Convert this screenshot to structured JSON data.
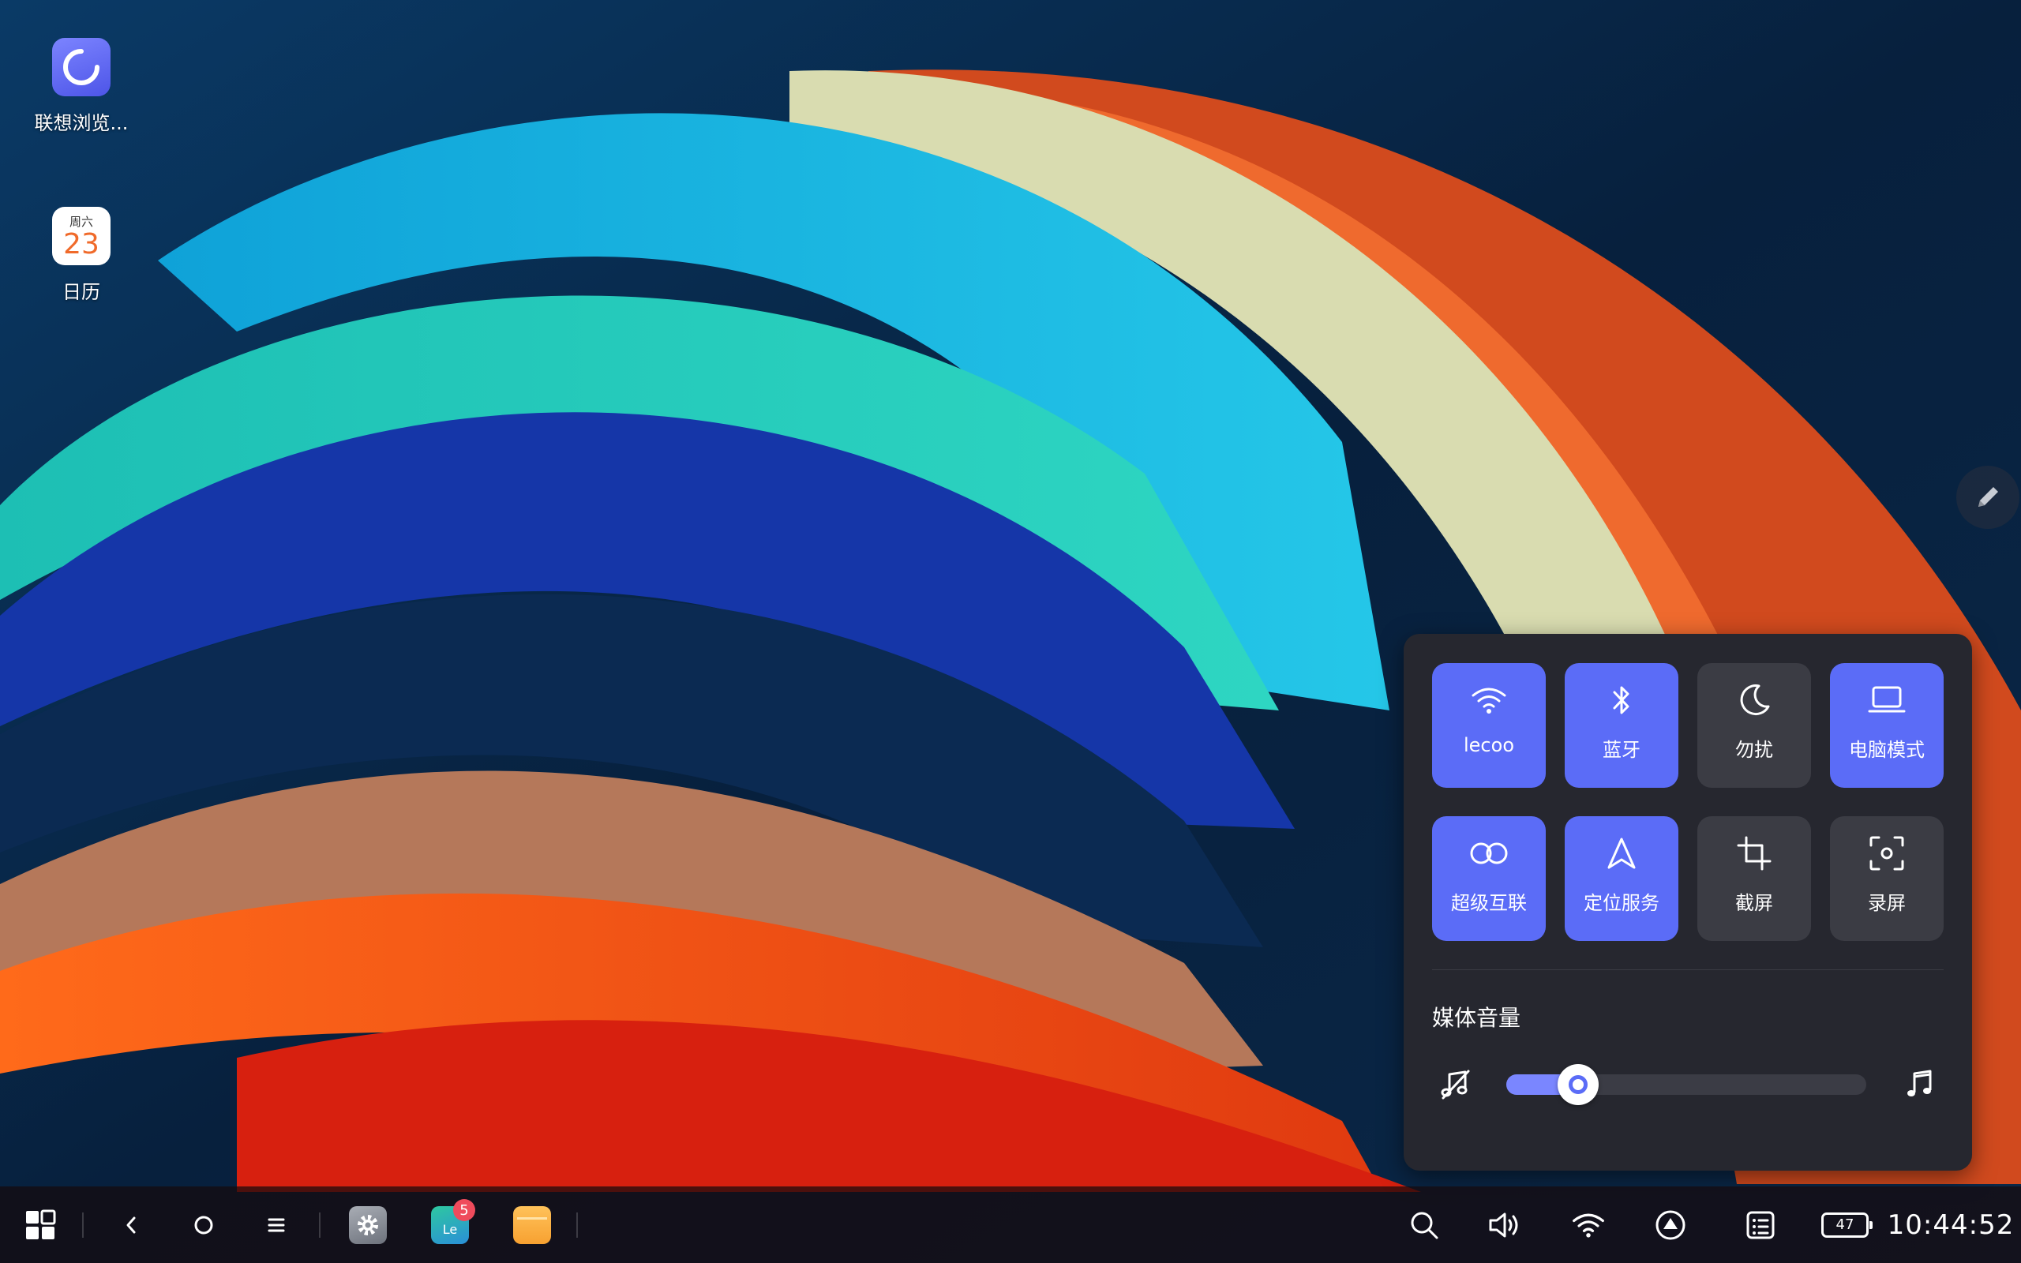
{
  "desktop": {
    "icons": [
      {
        "label": "联想浏览...",
        "icon": "browser-icon"
      },
      {
        "label": "日历",
        "icon": "calendar-icon",
        "weekday": "周六",
        "day": "23"
      }
    ]
  },
  "edge_button": {
    "icon": "pen-icon"
  },
  "quick_panel": {
    "tiles": [
      {
        "label": "lecoo",
        "icon": "wifi-icon",
        "active": true
      },
      {
        "label": "蓝牙",
        "icon": "bluetooth-icon",
        "active": true
      },
      {
        "label": "勿扰",
        "icon": "moon-icon",
        "active": false
      },
      {
        "label": "电脑模式",
        "icon": "laptop-icon",
        "active": true
      },
      {
        "label": "超级互联",
        "icon": "infinity-icon",
        "active": true
      },
      {
        "label": "定位服务",
        "icon": "location-icon",
        "active": true
      },
      {
        "label": "截屏",
        "icon": "crop-icon",
        "active": false
      },
      {
        "label": "录屏",
        "icon": "screen-record-icon",
        "active": false
      }
    ],
    "volume": {
      "title": "媒体音量",
      "level_fraction": 0.2,
      "min_icon": "music-mute-icon",
      "max_icon": "music-icon"
    },
    "colors": {
      "active": "#5b6cf7",
      "inactive": "#3b3c44",
      "panel": "#26272f"
    }
  },
  "taskbar": {
    "start_icon": "grid-icon",
    "nav": [
      "back-icon",
      "home-icon",
      "menu-icon"
    ],
    "apps": [
      {
        "icon": "settings-icon"
      },
      {
        "icon": "le-store-icon",
        "badge": "5",
        "text": "Le"
      },
      {
        "icon": "folder-icon"
      }
    ],
    "tray": [
      "search-icon",
      "volume-icon",
      "wifi-icon",
      "upload-icon",
      "notes-icon"
    ],
    "battery": "47",
    "time": "10:44:52"
  }
}
